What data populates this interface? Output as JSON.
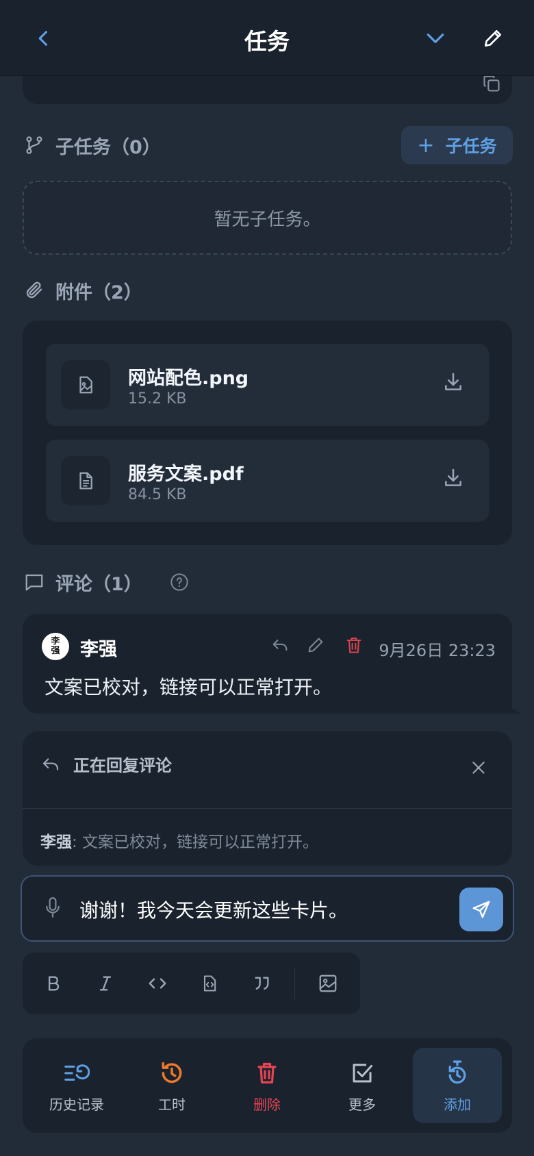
{
  "header": {
    "title": "任务"
  },
  "subtasks": {
    "heading": "子任务（0）",
    "add_label": "子任务",
    "empty_text": "暂无子任务。"
  },
  "attachments": {
    "heading": "附件（2）",
    "files": [
      {
        "name": "网站配色.png",
        "size": "15.2 KB",
        "icon": "image-file-icon"
      },
      {
        "name": "服务文案.pdf",
        "size": "84.5 KB",
        "icon": "document-file-icon"
      }
    ]
  },
  "comments": {
    "heading": "评论（1）",
    "items": [
      {
        "author": "李强",
        "avatar_text": "李强",
        "time": "9月26日 23:23",
        "text": "文案已校对，链接可以正常打开。"
      }
    ]
  },
  "reply": {
    "title": "正在回复评论",
    "quote_author": "李强",
    "quote_text": ": 文案已校对，链接可以正常打开。"
  },
  "composer": {
    "value": "谢谢！我今天会更新这些卡片。"
  },
  "bottom_nav": {
    "items": [
      {
        "label": "历史记录"
      },
      {
        "label": "工时"
      },
      {
        "label": "删除"
      },
      {
        "label": "更多"
      },
      {
        "label": "添加"
      }
    ]
  },
  "colors": {
    "accent": "#5fa1e6",
    "danger": "#e64553",
    "orange": "#f07a2b",
    "background": "#222c39",
    "card": "#1a222d"
  }
}
